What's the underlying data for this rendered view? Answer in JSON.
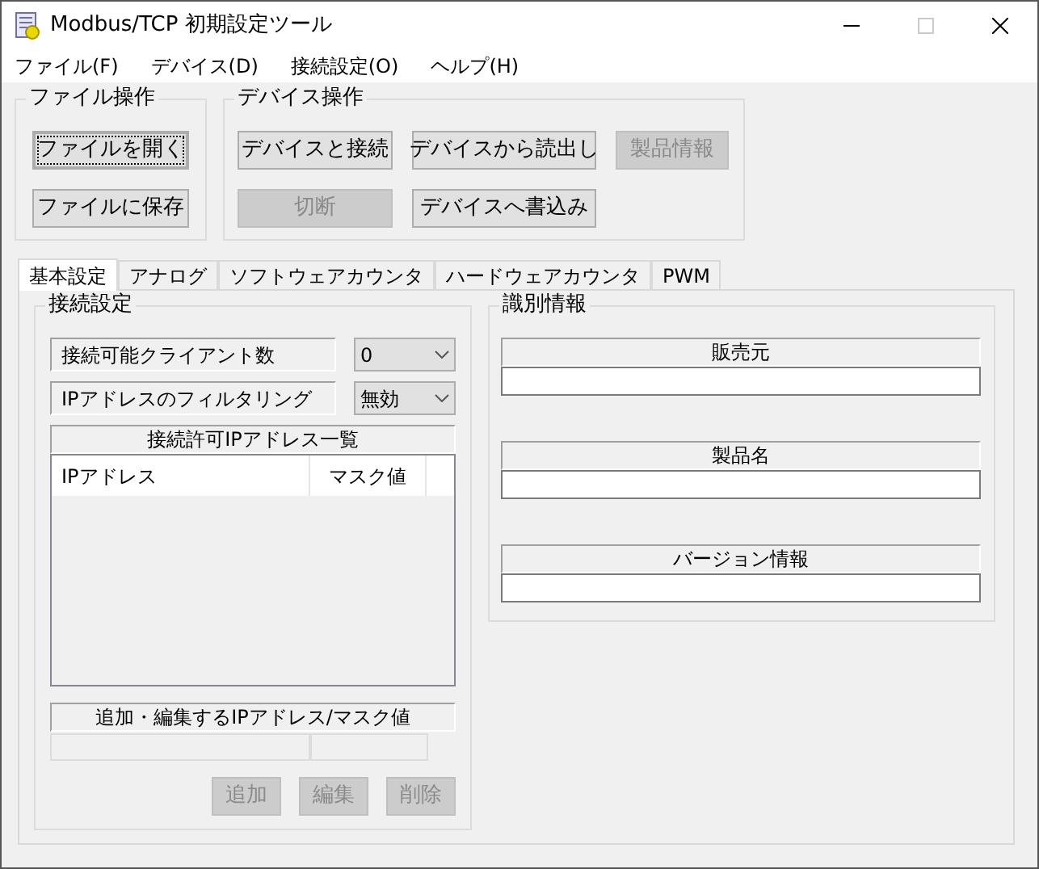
{
  "window": {
    "title": "Modbus/TCP 初期設定ツール",
    "controls": [
      {
        "kind": "minimize",
        "disabled": false
      },
      {
        "kind": "maximize",
        "disabled": true
      },
      {
        "kind": "close",
        "disabled": false
      }
    ]
  },
  "menu": [
    {
      "label": "ファイル(F)"
    },
    {
      "label": "デバイス(D)"
    },
    {
      "label": "接続設定(O)"
    },
    {
      "label": "ヘルプ(H)"
    }
  ],
  "file_ops": {
    "title": "ファイル操作",
    "buttons": [
      {
        "label": "ファイルを開く",
        "disabled": false,
        "focused": true
      },
      {
        "label": "ファイルに保存",
        "disabled": false,
        "focused": false
      }
    ]
  },
  "device_ops": {
    "title": "デバイス操作",
    "buttons": [
      {
        "label": "デバイスと接続",
        "disabled": false
      },
      {
        "label": "デバイスから読出し",
        "disabled": false
      },
      {
        "label": "製品情報",
        "disabled": true
      },
      {
        "label": "切断",
        "disabled": true
      },
      {
        "label": "デバイスへ書込み",
        "disabled": false
      }
    ]
  },
  "tabs": [
    {
      "label": "基本設定",
      "selected": true
    },
    {
      "label": "アナログ",
      "selected": false
    },
    {
      "label": "ソフトウェアカウンタ",
      "selected": false
    },
    {
      "label": "ハードウェアカウンタ",
      "selected": false
    },
    {
      "label": "PWM",
      "selected": false
    }
  ],
  "connection_settings": {
    "title": "接続設定",
    "fields": [
      {
        "label": "接続可能クライアント数",
        "value": "0"
      },
      {
        "label": "IPアドレスのフィルタリング",
        "value": "無効"
      }
    ],
    "ip_list": {
      "title": "接続許可IPアドレス一覧",
      "columns": [
        "IPアドレス",
        "マスク値"
      ]
    },
    "edit": {
      "title": "追加・編集するIPアドレス/マスク値"
    },
    "buttons": [
      {
        "label": "追加",
        "disabled": true
      },
      {
        "label": "編集",
        "disabled": true
      },
      {
        "label": "削除",
        "disabled": true
      }
    ]
  },
  "identification": {
    "title": "識別情報",
    "fields": [
      {
        "label": "販売元"
      },
      {
        "label": "製品名"
      },
      {
        "label": "バージョン情報"
      }
    ]
  }
}
